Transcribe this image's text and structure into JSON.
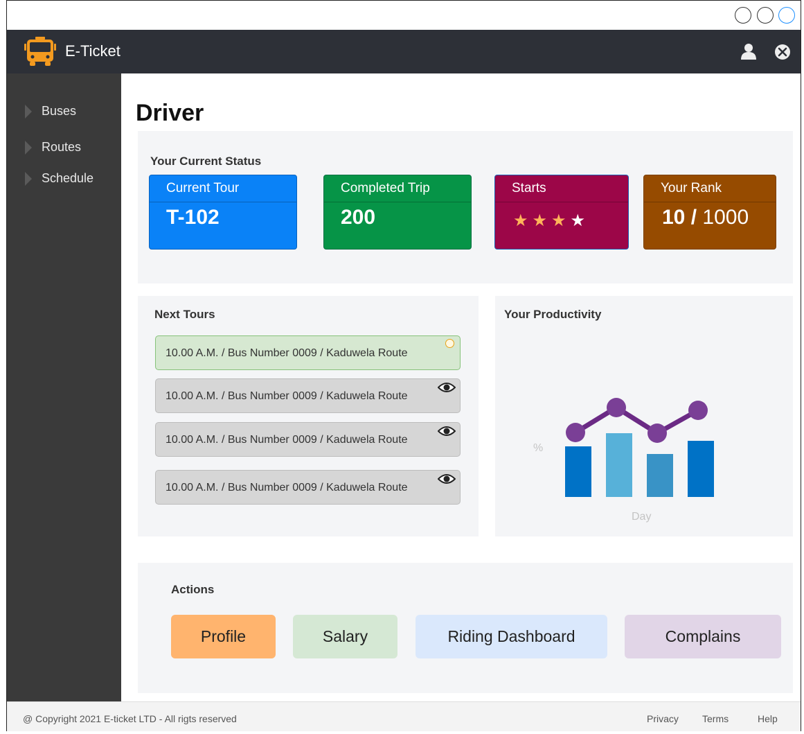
{
  "app": {
    "title": "E-Ticket",
    "icons": {
      "logo": "bus-icon",
      "user": "user-icon",
      "close": "close-icon"
    }
  },
  "sidebar": {
    "items": [
      {
        "label": "Buses"
      },
      {
        "label": "Routes"
      },
      {
        "label": "Schedule"
      }
    ]
  },
  "page": {
    "title": "Driver"
  },
  "status": {
    "title": "Your Current Status",
    "cards": [
      {
        "label": "Current Tour",
        "value": "T-102",
        "color": "#0a82f7"
      },
      {
        "label": "Completed Trip",
        "value": "200",
        "color": "#069447"
      },
      {
        "label": "Starts",
        "rating": 4,
        "max": 4,
        "color": "#9c0648"
      },
      {
        "label": "Your Rank",
        "rank": "10",
        "separator": " / ",
        "total": "1000",
        "color": "#964b00"
      }
    ]
  },
  "tours": {
    "title": "Next Tours",
    "items": [
      {
        "text": "10.00 A.M. / Bus Number 0009  / Kaduwela Route",
        "status": "active",
        "icon": "status-dot-icon"
      },
      {
        "text": "10.00 A.M. / Bus Number 0009  / Kaduwela Route",
        "status": "upcoming",
        "icon": "eye-icon"
      },
      {
        "text": "10.00 A.M. / Bus Number 0009  / Kaduwela Route",
        "status": "upcoming",
        "icon": "eye-icon"
      },
      {
        "text": "10.00 A.M. / Bus Number 0009  / Kaduwela Route",
        "status": "upcoming",
        "icon": "eye-icon"
      }
    ]
  },
  "productivity": {
    "title": "Your Productivity",
    "y_label": "%",
    "x_label": "Day",
    "chart_data": {
      "type": "bar",
      "bars": [
        73,
        92,
        62,
        81
      ],
      "line": [
        93,
        129,
        92,
        125
      ],
      "bar_colors": [
        "#0072c6",
        "#57b1d9",
        "#3993c6",
        "#0072c6"
      ],
      "line_color": "#6b2a85",
      "marker_color": "#7a3f96",
      "ylim": [
        0,
        145
      ]
    }
  },
  "actions": {
    "title": "Actions",
    "buttons": [
      {
        "label": "Profile"
      },
      {
        "label": "Salary"
      },
      {
        "label": "Riding Dashboard"
      },
      {
        "label": "Complains"
      }
    ]
  },
  "footer": {
    "copyright": "@ Copyright 2021 E-ticket LTD - All rigts reserved",
    "links": [
      "Privacy",
      "Terms",
      "Help"
    ]
  }
}
